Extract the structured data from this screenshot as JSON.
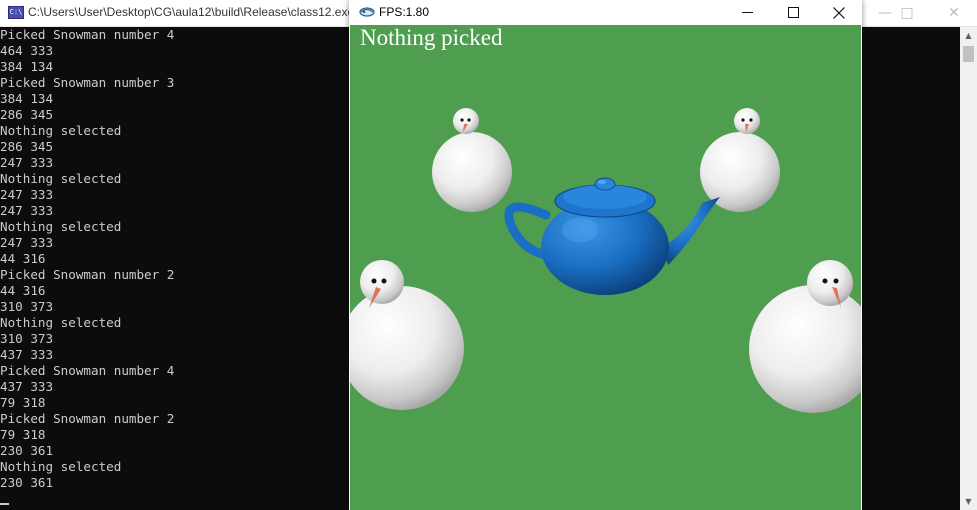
{
  "console": {
    "title": "C:\\Users\\User\\Desktop\\CG\\aula12\\build\\Release\\class12.exe",
    "lines": [
      "Picked Snowman number 4",
      "464 333",
      "384 134",
      "Picked Snowman number 3",
      "384 134",
      "286 345",
      "Nothing selected",
      "286 345",
      "247 333",
      "Nothing selected",
      "247 333",
      "247 333",
      "Nothing selected",
      "247 333",
      "44 316",
      "Picked Snowman number 2",
      "44 316",
      "310 373",
      "Nothing selected",
      "310 373",
      "437 333",
      "Picked Snowman number 4",
      "437 333",
      "79 318",
      "Picked Snowman number 2",
      "79 318",
      "230 361",
      "Nothing selected",
      "230 361"
    ]
  },
  "gl_window": {
    "title": "FPS:1.80",
    "status_text": "Nothing picked"
  },
  "colors": {
    "scene_background": "#4f9e4f",
    "teapot": "#1a6fc4",
    "console_background": "#0c0c0c",
    "console_text": "#cccccc"
  },
  "icons": {
    "console_app": "console-app-icon",
    "glut_app": "glut-app-icon",
    "minimize": "minimize-icon",
    "maximize": "maximize-icon",
    "close": "close-icon"
  }
}
